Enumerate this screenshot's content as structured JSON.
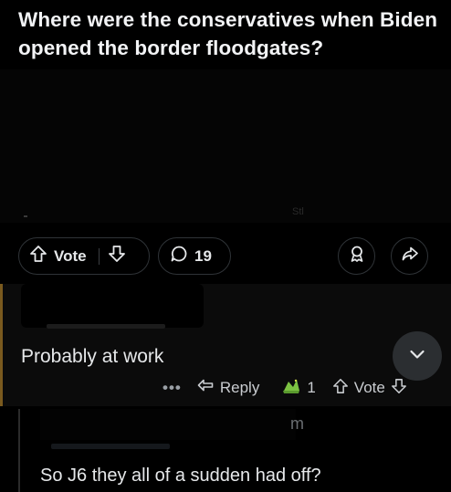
{
  "post": {
    "title": "Where were the conservatives when Biden opened the border floodgates?",
    "body_ghost": "Stl"
  },
  "actions": {
    "vote_label": "Vote",
    "comment_count": "19"
  },
  "comment1": {
    "text": "Probably at work",
    "more": "•••",
    "reply_label": "Reply",
    "award_count": "1",
    "vote_label": "Vote"
  },
  "comment2": {
    "ghost": "m",
    "text": "So J6 they all of a sudden had off?"
  }
}
